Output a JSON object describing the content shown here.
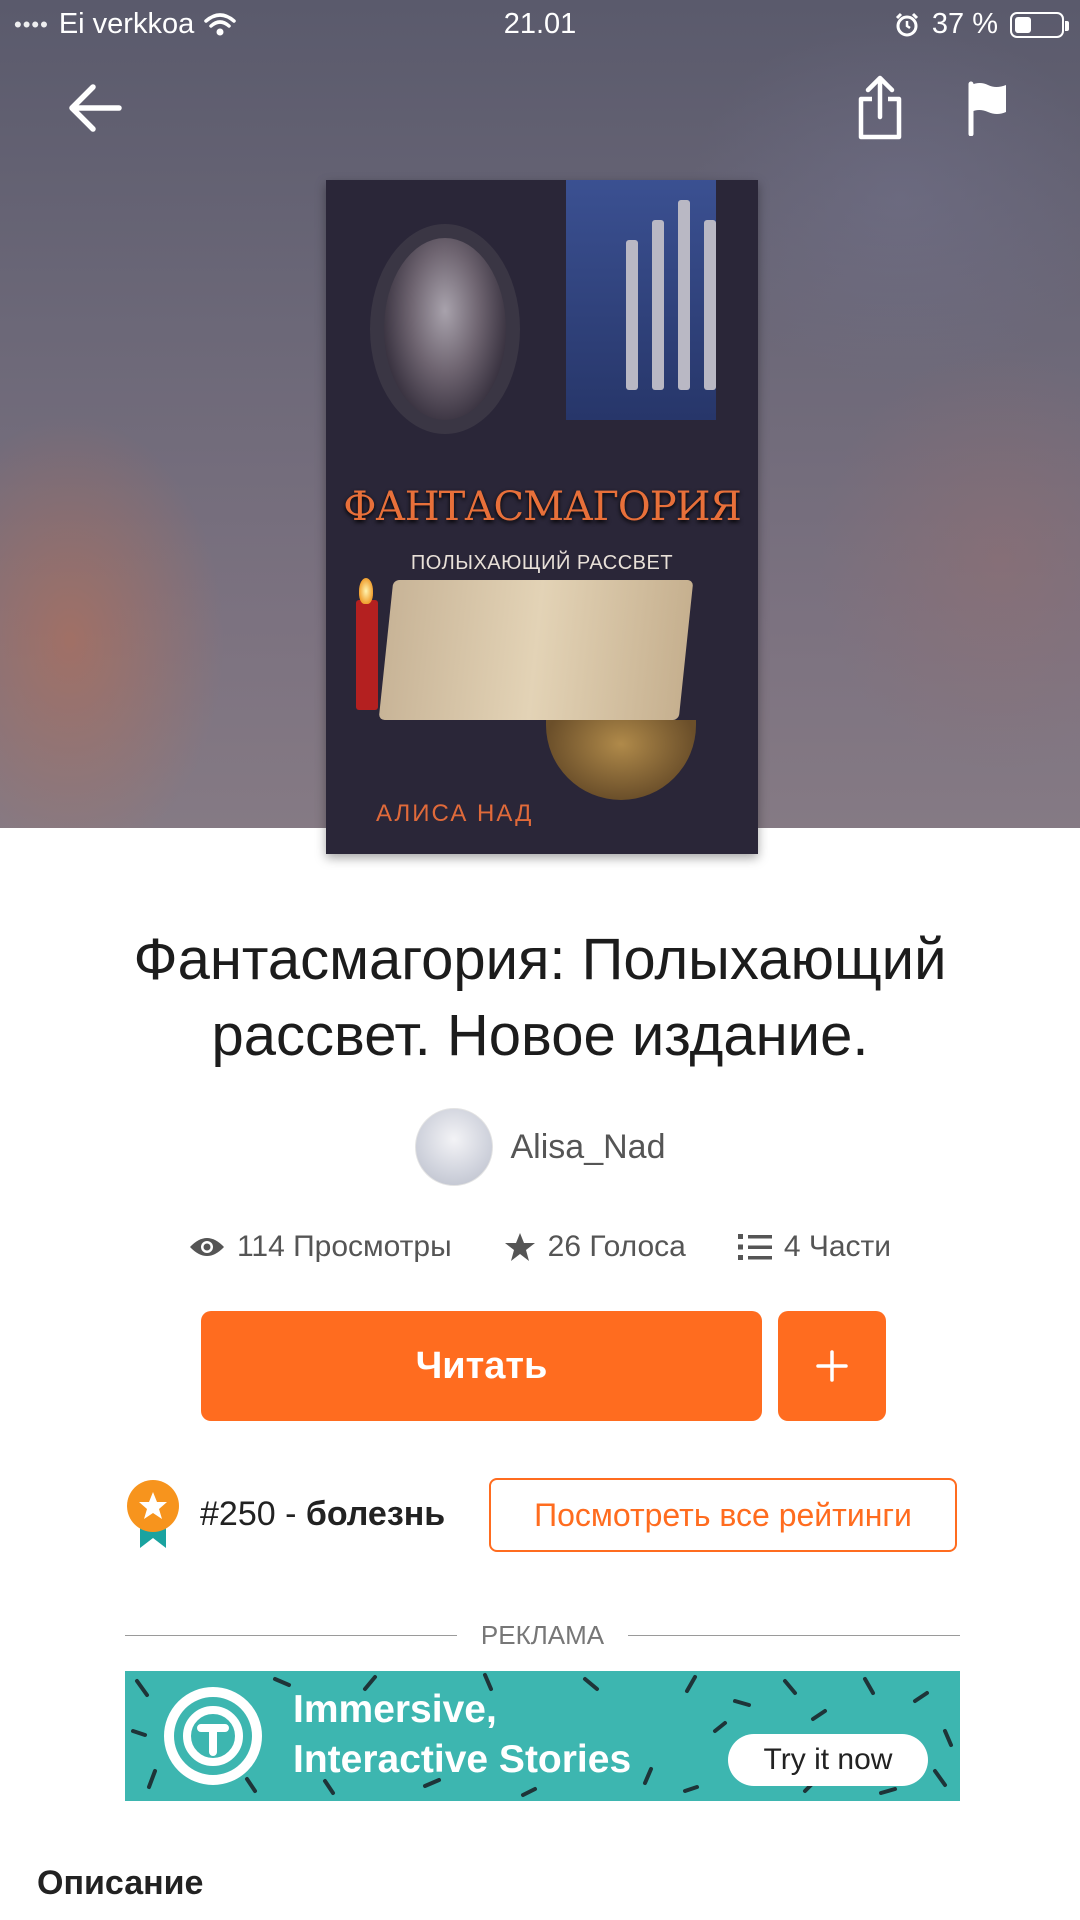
{
  "status_bar": {
    "carrier": "Ei verkkoa",
    "time": "21.01",
    "battery": "37 %",
    "battery_level": 0.37
  },
  "nav": {
    "back_icon": "arrow-left-icon",
    "share_icon": "share-icon",
    "flag_icon": "flag-icon"
  },
  "cover": {
    "title": "ФАНТАСМАГОРИЯ",
    "subtitle": "ПОЛЫХАЮЩИЙ РАССВЕТ",
    "author": "АЛИСА НАД"
  },
  "story": {
    "title": "Фантасмагория: Полыхающий рассвет. Новое издание.",
    "author": "Alisa_Nad"
  },
  "stats": {
    "views": "114 Просмотры",
    "votes": "26 Голоса",
    "parts": "4 Части"
  },
  "actions": {
    "read_label": "Читать",
    "add_icon": "plus-icon"
  },
  "ranking": {
    "rank": "#250",
    "separator": " - ",
    "tag": "болезнь",
    "view_all_label": "Посмотреть все рейтинги"
  },
  "ad": {
    "label": "РЕКЛАМА",
    "headline_1": "Immersive,",
    "headline_2": "Interactive Stories",
    "cta": "Try it now"
  },
  "description_heading": "Описание",
  "colors": {
    "accent": "#ff6c1f",
    "ad_background": "#3db6b0",
    "text": "#222222"
  }
}
